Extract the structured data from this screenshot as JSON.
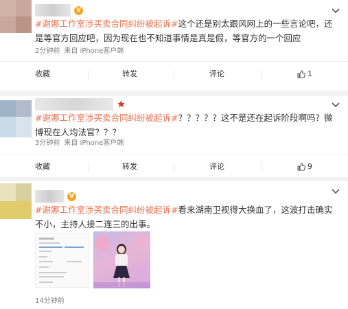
{
  "posts": [
    {
      "hashtag": "#谢娜工作室涉买卖合同纠纷被起诉#",
      "text": "这个还是别太跟风网上的一些言论吧，还是等官方回应吧，因为现在也不知道事情是真是假，等官方的一个回应",
      "time": "2分钟前",
      "source": "来自 iPhone客户端",
      "collect_label": "收藏",
      "repost_label": "转发",
      "comment_label": "评论",
      "like_count": "1"
    },
    {
      "hashtag": "#谢娜工作室涉买卖合同纠纷被起诉#",
      "text": "？？？？？这不是还在起诉阶段啊吗？微博现在人均法官？？？",
      "time": "3分钟前",
      "source": "来自 iPhone客户端",
      "collect_label": "收藏",
      "repost_label": "转发",
      "comment_label": "评论",
      "like_count": "9"
    },
    {
      "hashtag": "#谢娜工作室涉买卖合同纠纷被起诉#",
      "text": "看来湖南卫视得大换血了，这波打击确实不小，主持人接二连三的出事。",
      "time": "14分钟前"
    }
  ],
  "colors": {
    "hashtag": "#eb7350",
    "vip_badge": "#f5a623",
    "red_badge": "#e03a2f",
    "meta_text": "#808080"
  },
  "icons": [
    "chevron-down-icon",
    "like-icon",
    "vip-badge-icon",
    "star-badge-icon"
  ]
}
